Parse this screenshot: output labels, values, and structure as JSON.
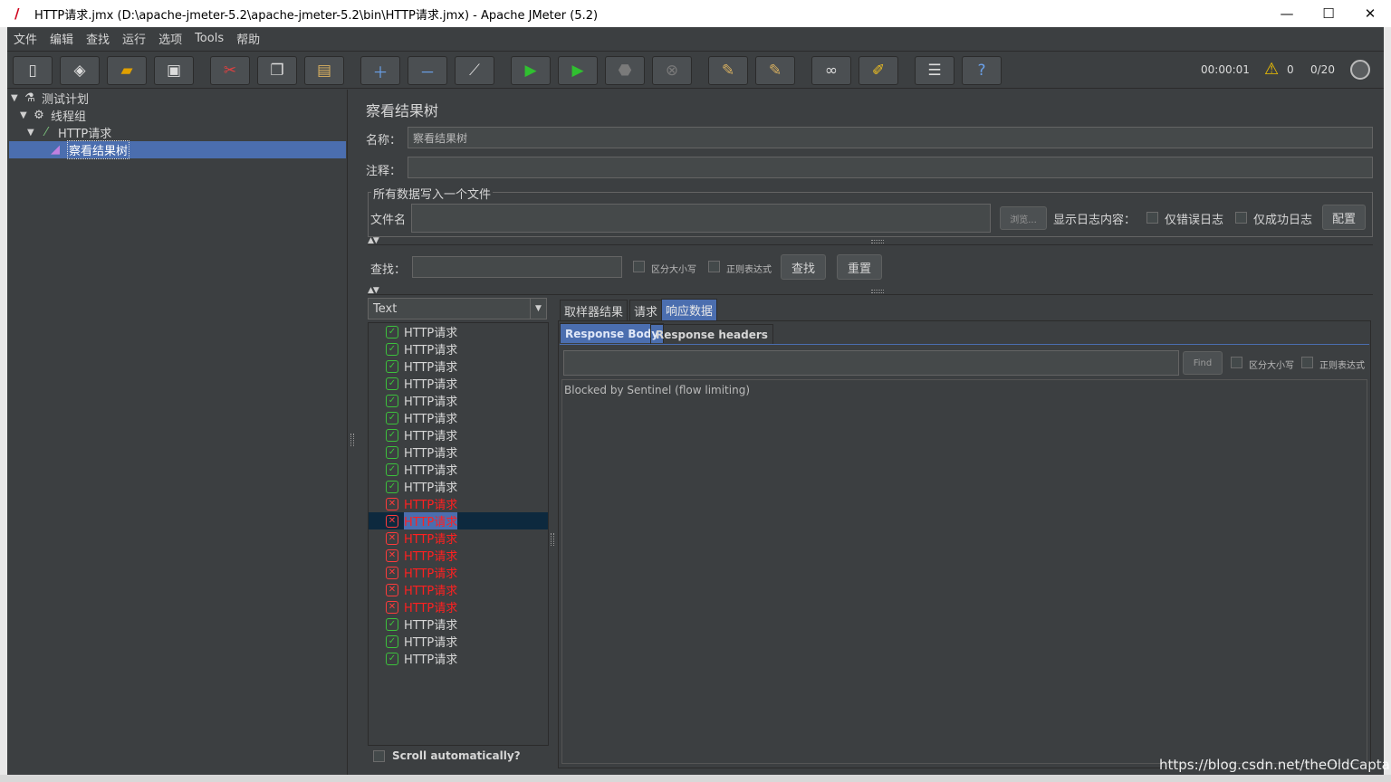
{
  "window": {
    "title": "HTTP请求.jmx (D:\\apache-jmeter-5.2\\apache-jmeter-5.2\\bin\\HTTP请求.jmx) - Apache JMeter (5.2)",
    "minimize": "—",
    "maximize": "☐",
    "close": "✕"
  },
  "menu": {
    "items": [
      "文件",
      "编辑",
      "查找",
      "运行",
      "选项",
      "Tools",
      "帮助"
    ]
  },
  "status": {
    "timer": "00:00:01",
    "error_count": "0",
    "threads": "0/20"
  },
  "tree": {
    "nodes": [
      {
        "label": "测试计划"
      },
      {
        "label": "线程组"
      },
      {
        "label": "HTTP请求"
      },
      {
        "label": "察看结果树"
      }
    ]
  },
  "panel": {
    "title": "察看结果树",
    "name_label": "名称：",
    "name_value": "察看结果树",
    "comment_label": "注释：",
    "comment_value": "",
    "file_group_title": "所有数据写入一个文件",
    "filename_label": "文件名",
    "filename_value": "",
    "browse_button": "浏览...",
    "log_label": "显示日志内容：",
    "errors_only": "仅错误日志",
    "success_only": "仅成功日志",
    "configure_button": "配置",
    "search_label": "查找：",
    "case_sensitive": "区分大小写",
    "regex": "正则表达式",
    "find_button": "查找",
    "reset_button": "重置"
  },
  "results": {
    "renderer": "Text",
    "items": [
      {
        "label": "HTTP请求",
        "status": "ok"
      },
      {
        "label": "HTTP请求",
        "status": "ok"
      },
      {
        "label": "HTTP请求",
        "status": "ok"
      },
      {
        "label": "HTTP请求",
        "status": "ok"
      },
      {
        "label": "HTTP请求",
        "status": "ok"
      },
      {
        "label": "HTTP请求",
        "status": "ok"
      },
      {
        "label": "HTTP请求",
        "status": "ok"
      },
      {
        "label": "HTTP请求",
        "status": "ok"
      },
      {
        "label": "HTTP请求",
        "status": "ok"
      },
      {
        "label": "HTTP请求",
        "status": "ok"
      },
      {
        "label": "HTTP请求",
        "status": "error"
      },
      {
        "label": "HTTP请求",
        "status": "error",
        "selected": true
      },
      {
        "label": "HTTP请求",
        "status": "error"
      },
      {
        "label": "HTTP请求",
        "status": "error"
      },
      {
        "label": "HTTP请求",
        "status": "error"
      },
      {
        "label": "HTTP请求",
        "status": "error"
      },
      {
        "label": "HTTP请求",
        "status": "error"
      },
      {
        "label": "HTTP请求",
        "status": "ok"
      },
      {
        "label": "HTTP请求",
        "status": "ok"
      },
      {
        "label": "HTTP请求",
        "status": "ok"
      }
    ],
    "scroll_auto": "Scroll automatically?"
  },
  "tabs": {
    "main": [
      "取样器结果",
      "请求",
      "响应数据"
    ],
    "sub": [
      "Response Body",
      "Response headers"
    ]
  },
  "response": {
    "find_button": "Find",
    "case_sensitive": "区分大小写",
    "regex": "正则表达式",
    "body": "Blocked by Sentinel (flow limiting)"
  },
  "watermark": "https://blog.csdn.net/theOldCaptain",
  "colors": {
    "background": "#3c3f41",
    "selection": "#4b6eaf",
    "error_text": "#ff2020",
    "ok_icon": "#3cc23c"
  }
}
